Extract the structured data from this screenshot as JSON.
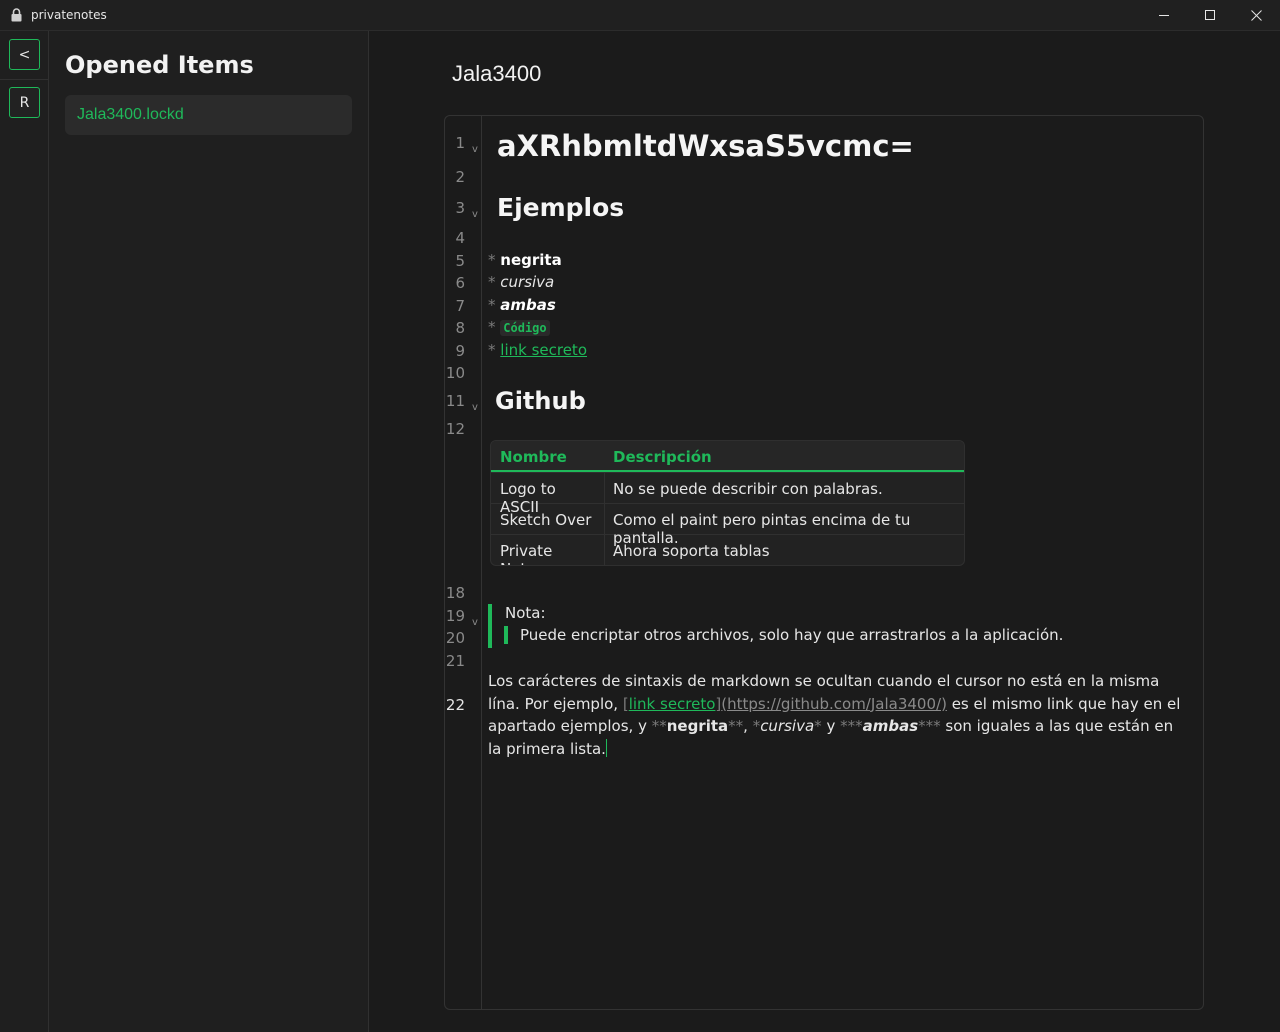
{
  "window": {
    "title": "privatenotes",
    "minimize": "—",
    "maximize": "☐",
    "close": "✕"
  },
  "rail": {
    "collapse_label": "<",
    "r_label": "R"
  },
  "sidebar": {
    "title": "Opened Items",
    "items": [
      {
        "label": "Jala3400.lockd"
      }
    ]
  },
  "doc": {
    "title": "Jala3400",
    "line_numbers": [
      "1",
      "2",
      "3",
      "4",
      "5",
      "6",
      "7",
      "8",
      "9",
      "10",
      "11",
      "12",
      "18",
      "19",
      "20",
      "21",
      "22"
    ],
    "fold_marker": "v",
    "heading1": "aXRhbmltdWxsaS5vcmc=",
    "heading_examples": "Ejemplos",
    "bullet_marker": "*",
    "list": {
      "bold": "negrita",
      "italic": "cursiva",
      "both": "ambas",
      "code": "Código",
      "link": "link secreto"
    },
    "heading_github": "Github",
    "table": {
      "headers": [
        "Nombre",
        "Descripción"
      ],
      "rows": [
        [
          "Logo to ASCII",
          "No se puede describir con palabras."
        ],
        [
          "Sketch Over",
          "Como el paint pero pintas encima de tu pantalla."
        ],
        [
          "Private Notes",
          "Ahora soporta tablas"
        ]
      ]
    },
    "quote_title": "Nota:",
    "quote_body": "Puede encriptar otros archivos, solo hay que arrastrarlos a la aplicación.",
    "para": {
      "p1": "Los carácteres de sintaxis de markdown se ocultan cuando el cursor no está en la misma lína. Por ejemplo, ",
      "lb": "[",
      "link_text": "link secreto",
      "rb": "]",
      "url": "(https://github.com/Jala3400/)",
      "p2": " es el mismo link que hay en el apartado ejemplos, y ",
      "m2": "**",
      "bold": "negrita",
      "p3": ", ",
      "m1": "*",
      "italic": "cursiva",
      "p4": " y ",
      "m3": "***",
      "both": "ambas",
      "p5": " son iguales a las que están en la primera lista."
    }
  },
  "colors": {
    "accent": "#1fb95a",
    "background": "#1b1b1b",
    "sidebar": "#1f1f1f"
  }
}
